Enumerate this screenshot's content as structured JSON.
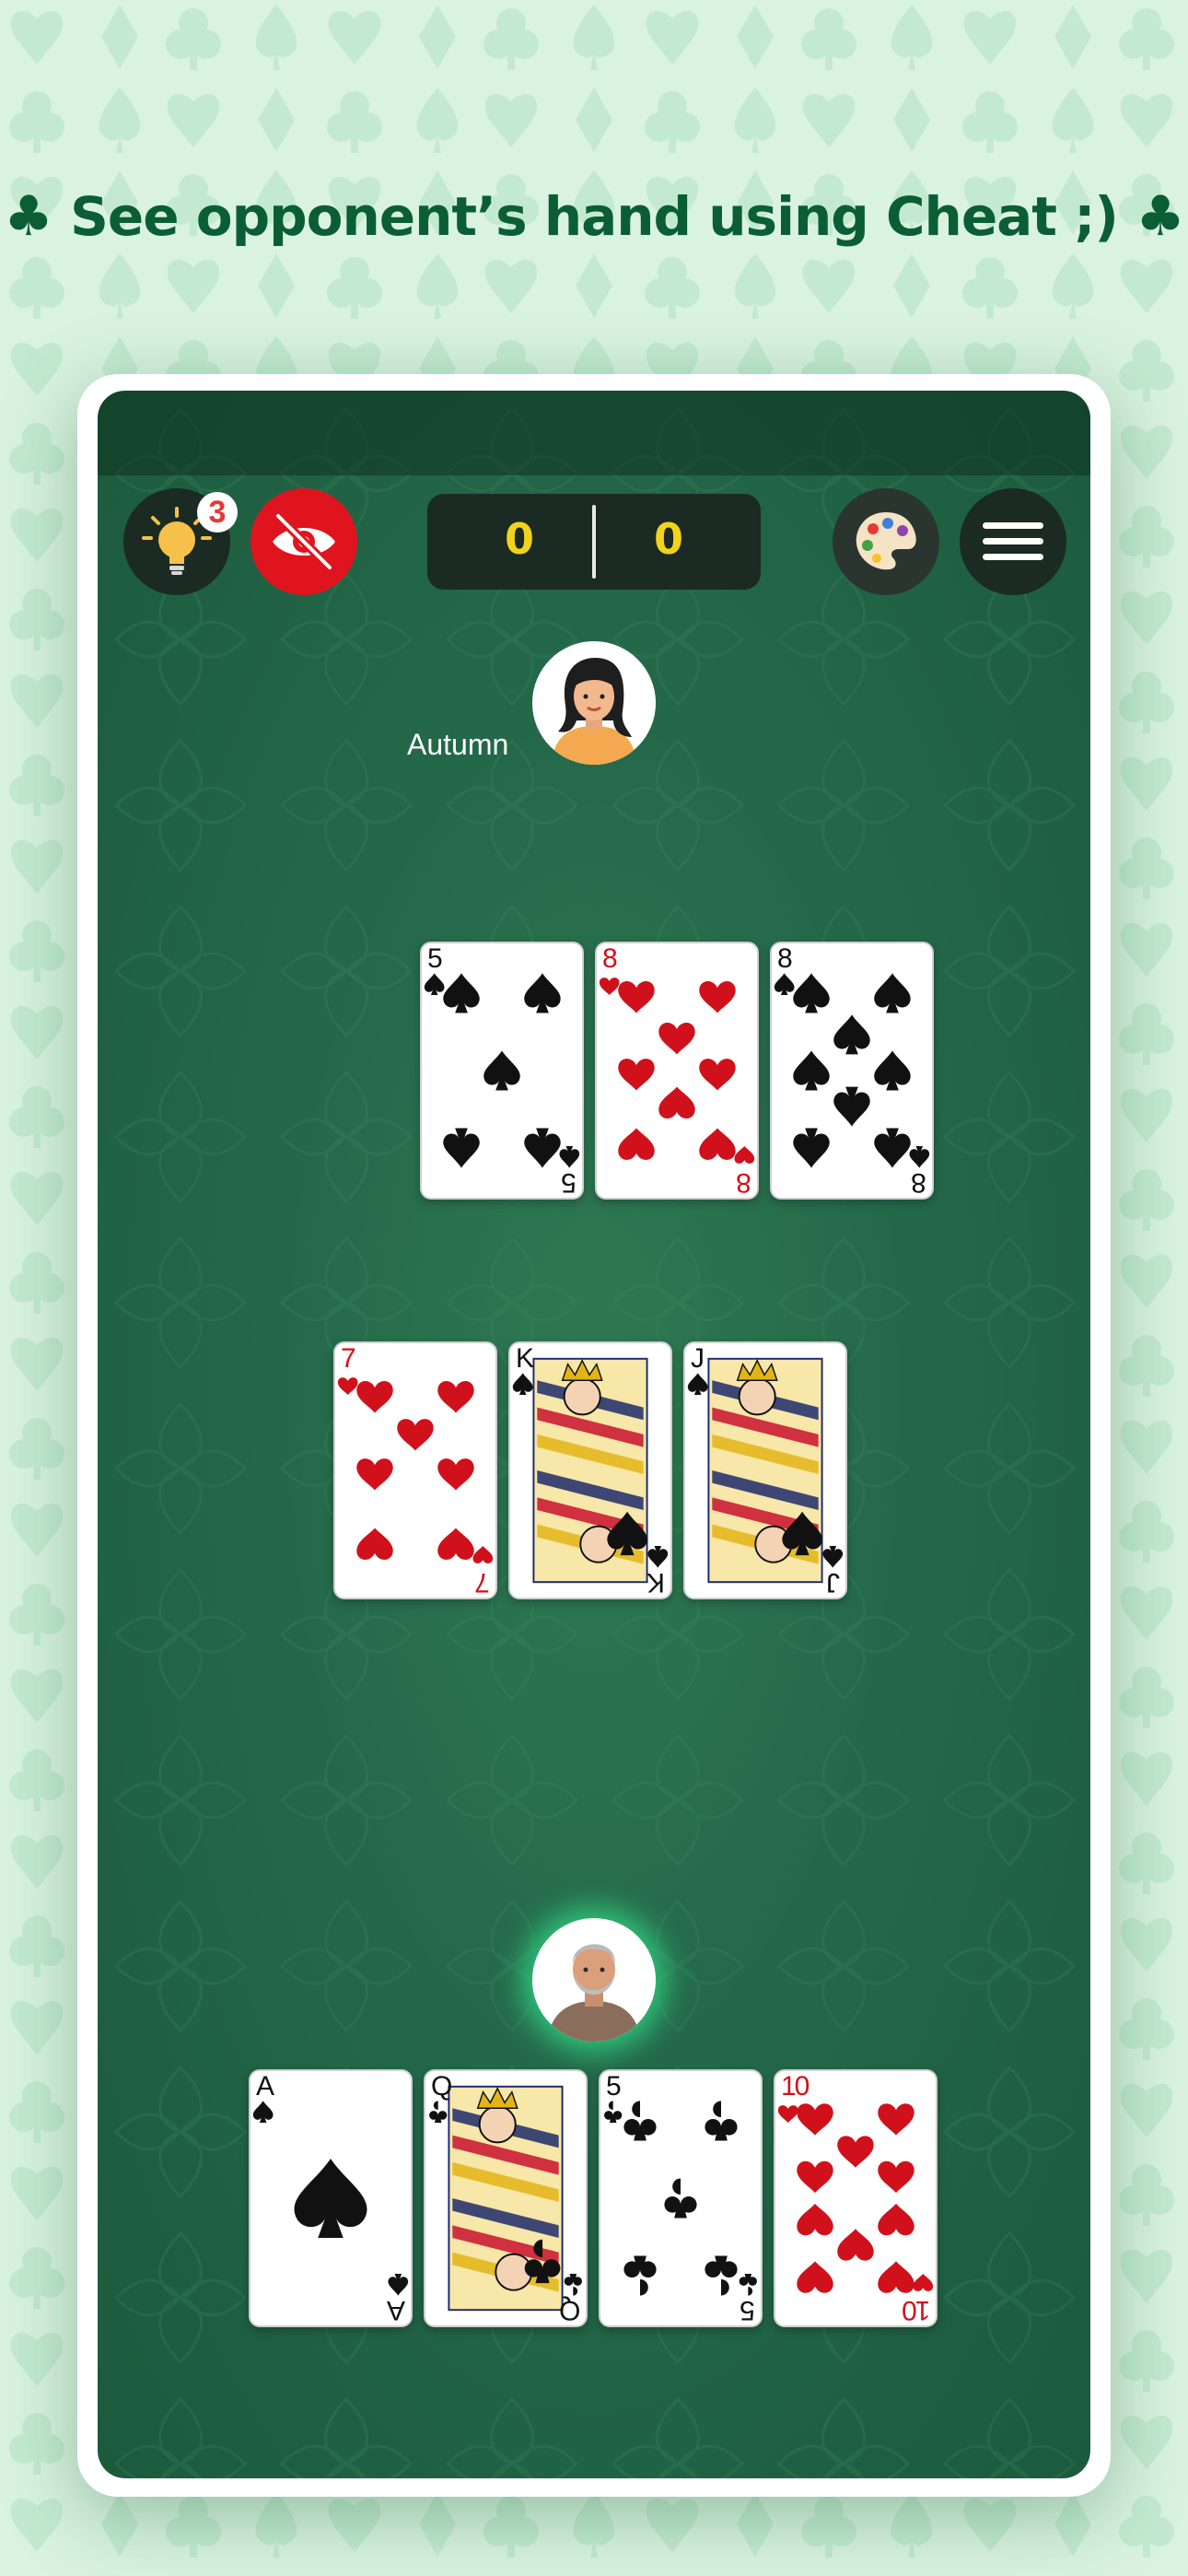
{
  "headline": {
    "text": "See opponent’s hand using Cheat ;)",
    "left_glyph": "♣",
    "right_glyph": "♣"
  },
  "toolbar": {
    "hint_badge": "3",
    "score_left": "0",
    "score_right": "0"
  },
  "opponent": {
    "name": "Autumn",
    "hand": [
      {
        "rank": "5",
        "suit": "spades"
      },
      {
        "rank": "8",
        "suit": "hearts"
      },
      {
        "rank": "8",
        "suit": "spades"
      }
    ]
  },
  "table_cards": [
    {
      "rank": "7",
      "suit": "hearts"
    },
    {
      "rank": "K",
      "suit": "spades"
    },
    {
      "rank": "J",
      "suit": "spades"
    }
  ],
  "player": {
    "hand": [
      {
        "rank": "A",
        "suit": "spades"
      },
      {
        "rank": "Q",
        "suit": "clubs"
      },
      {
        "rank": "5",
        "suit": "clubs"
      },
      {
        "rank": "10",
        "suit": "hearts"
      }
    ]
  },
  "colors": {
    "headline": "#0b5e33",
    "felt": "#24684a",
    "score": "#f2d31b",
    "cheat_button": "#e0141e",
    "active_glow": "#33e08a"
  },
  "icons": [
    "lightbulb-icon",
    "eye-off-icon",
    "palette-icon",
    "menu-icon"
  ]
}
